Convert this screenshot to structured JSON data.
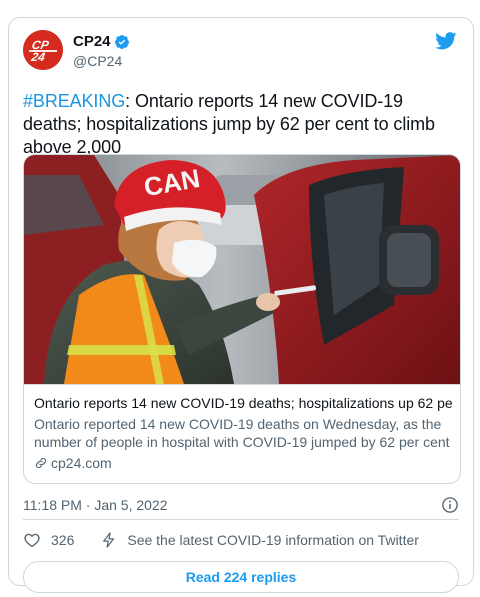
{
  "account": {
    "display_name": "CP24",
    "handle": "@CP24",
    "avatar_text": "CP24",
    "brand_color": "#d52b1e",
    "verified_icon": "verified-badge-icon"
  },
  "tweet": {
    "hashtag": "#BREAKING",
    "text": ": Ontario reports 14 new COVID-19 deaths; hospitalizations jump by 62 per cent to climb above 2,000"
  },
  "link_card": {
    "image_icon": "vaccination-photo",
    "title": "Ontario reports 14 new COVID-19 deaths; hospitalizations up 62 per ...",
    "description_line1": "Ontario reported 14 new COVID-19 deaths on Wednesday, as the",
    "description_line2": "number of people in hospital with COVID-19 jumped by 62 per cent i...",
    "domain": "cp24.com"
  },
  "meta": {
    "timestamp": "11:18 PM · Jan 5, 2022"
  },
  "actions": {
    "likes": "326",
    "covid_info": "See the latest COVID-19 information on Twitter",
    "read_replies": "Read 224 replies"
  },
  "colors": {
    "link_blue": "#1d9bf0",
    "hashtag_blue": "#1b95e0",
    "secondary_text": "#536471",
    "border": "#cfd9de"
  }
}
